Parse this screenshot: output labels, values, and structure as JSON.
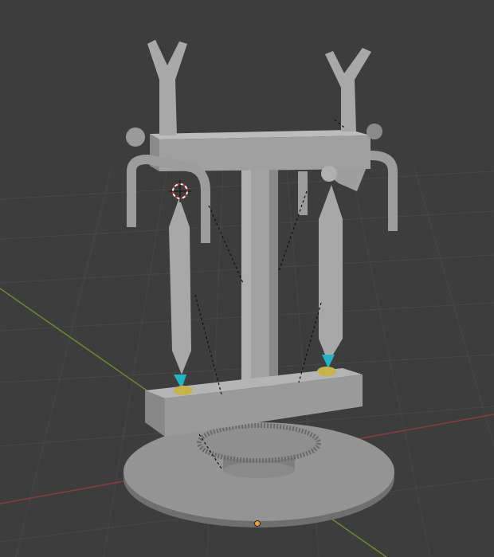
{
  "viewport": {
    "background": "#3d3d3d",
    "grid_color": "#474747",
    "x_axis_color": "#8a3a3e",
    "y_axis_color": "#6a8a2e",
    "model_color": "#9a9a9a",
    "tip_color": "#1fb5c6",
    "holder_color": "#c9b24a",
    "origin_color": "#f0a030",
    "icons": [
      "3d-cursor-icon",
      "object-origin-icon"
    ]
  }
}
